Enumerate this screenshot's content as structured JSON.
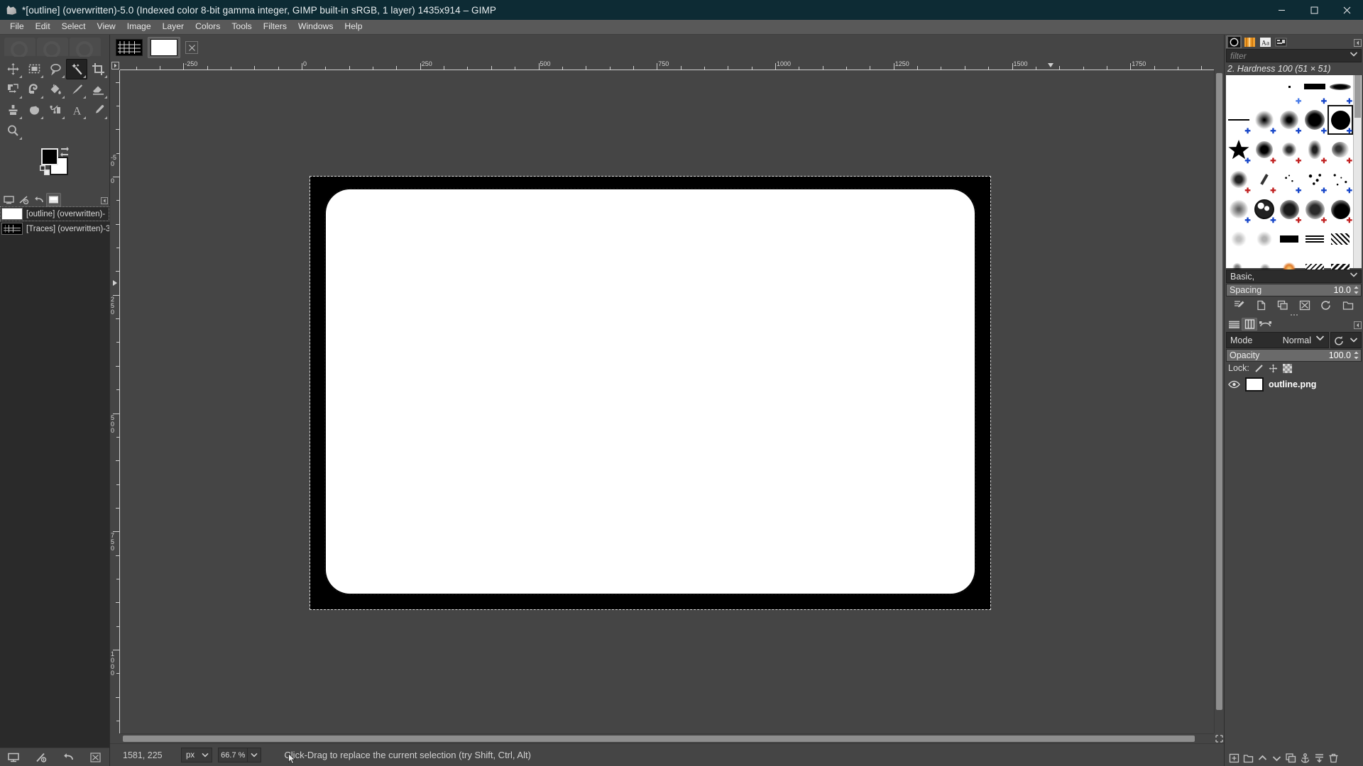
{
  "window": {
    "title": "*[outline] (overwritten)-5.0 (Indexed color 8-bit gamma integer, GIMP built-in sRGB, 1 layer) 1435x914 – GIMP",
    "app_icon": "wilber-icon",
    "controls": {
      "minimize": "−",
      "maximize": "▢",
      "close": "✕"
    }
  },
  "menubar": {
    "items": [
      {
        "label": "File"
      },
      {
        "label": "Edit"
      },
      {
        "label": "Select"
      },
      {
        "label": "View"
      },
      {
        "label": "Image"
      },
      {
        "label": "Layer"
      },
      {
        "label": "Colors"
      },
      {
        "label": "Tools"
      },
      {
        "label": "Filters"
      },
      {
        "label": "Windows"
      },
      {
        "label": "Help"
      }
    ]
  },
  "toolbox": {
    "tools": [
      {
        "name": "move-tool",
        "icon": "move-icon",
        "active": false
      },
      {
        "name": "rectangle-select-tool",
        "icon": "rectangle-select-icon",
        "active": false
      },
      {
        "name": "free-select-tool",
        "icon": "lasso-icon",
        "active": false
      },
      {
        "name": "fuzzy-select-tool",
        "icon": "magic-wand-icon",
        "active": true
      },
      {
        "name": "crop-tool",
        "icon": "crop-icon",
        "active": false
      },
      {
        "name": "unified-transform-tool",
        "icon": "transform-icon",
        "active": false
      },
      {
        "name": "warp-transform-tool",
        "icon": "warp-icon",
        "active": false
      },
      {
        "name": "bucket-fill-tool",
        "icon": "bucket-fill-icon",
        "active": false
      },
      {
        "name": "paintbrush-tool",
        "icon": "paintbrush-icon",
        "active": false
      },
      {
        "name": "eraser-tool",
        "icon": "eraser-icon",
        "active": false
      },
      {
        "name": "clone-tool",
        "icon": "clone-stamp-icon",
        "active": false
      },
      {
        "name": "smudge-tool",
        "icon": "smudge-icon",
        "active": false
      },
      {
        "name": "paths-tool",
        "icon": "paths-icon",
        "active": false
      },
      {
        "name": "text-tool",
        "icon": "text-icon",
        "active": false
      },
      {
        "name": "color-picker-tool",
        "icon": "eyedropper-icon",
        "active": false
      },
      {
        "name": "zoom-tool",
        "icon": "magnifier-icon",
        "active": false
      }
    ],
    "colors": {
      "foreground": "#000000",
      "background": "#ffffff",
      "swap_icon": "swap-colors-icon",
      "reset_icon": "reset-colors-icon"
    }
  },
  "images_dock": {
    "tabs": [
      {
        "name": "tab-images",
        "icon": "images-icon",
        "selected": false
      },
      {
        "name": "tab-document-history",
        "icon": "history-icon",
        "selected": false
      },
      {
        "name": "tab-undo-history",
        "icon": "undo-icon",
        "selected": false
      },
      {
        "name": "tab-layers-thumb",
        "icon": "layer-thumb-icon",
        "selected": true
      }
    ],
    "items": [
      {
        "label": "[outline] (overwritten)-",
        "thumb": "white",
        "selected": true
      },
      {
        "label": "[Traces] (overwritten)-3",
        "thumb": "traces",
        "selected": false
      }
    ]
  },
  "left_bottom_buttons": [
    {
      "name": "new-image-button",
      "icon": "canvas-icon"
    },
    {
      "name": "raise-image-button",
      "icon": "slash-zero-icon"
    },
    {
      "name": "delete-image-button",
      "icon": "delete-icon"
    }
  ],
  "canvas_tabs": [
    {
      "name": "canvas-tab-traces",
      "thumb": "traces",
      "selected": false,
      "closable": false
    },
    {
      "name": "canvas-tab-outline",
      "thumb": "white",
      "selected": true,
      "closable": true,
      "close_label": "⊠"
    }
  ],
  "rulers": {
    "horizontal": [
      "-250",
      "0",
      "250",
      "500",
      "750",
      "1000",
      "1250",
      "1500",
      "1750"
    ],
    "vertical": [
      "-50",
      "0",
      "250",
      "500",
      "750",
      "1000"
    ],
    "unit": "px"
  },
  "statusbar": {
    "position": "1581, 225",
    "unit": "px",
    "zoom": "66.7 %",
    "hint": "Click-Drag to replace the current selection (try Shift, Ctrl, Alt)"
  },
  "brushes_panel": {
    "tabs": [
      {
        "name": "tab-brushes",
        "icon": "brush-circle-icon",
        "selected": true
      },
      {
        "name": "tab-patterns",
        "icon": "gradient-icon",
        "selected": false
      },
      {
        "name": "tab-fonts",
        "icon": "font-aa-icon",
        "selected": false
      },
      {
        "name": "tab-templates",
        "icon": "template-icon",
        "selected": false
      }
    ],
    "collapse_icon": "collapse-left-icon",
    "filter_placeholder": "filter",
    "selected_brush": "2. Hardness 100 (51 × 51)",
    "tag_selector": "Basic,",
    "spacing_label": "Spacing",
    "spacing_value": "10.0",
    "actions": [
      {
        "name": "edit-brush-button",
        "icon": "edit-icon"
      },
      {
        "name": "new-brush-button",
        "icon": "new-doc-icon"
      },
      {
        "name": "duplicate-brush-button",
        "icon": "duplicate-icon"
      },
      {
        "name": "delete-brush-button",
        "icon": "delete-x-icon"
      },
      {
        "name": "refresh-brushes-button",
        "icon": "refresh-icon"
      },
      {
        "name": "open-brush-folder-button",
        "icon": "folder-icon"
      }
    ]
  },
  "layers_panel": {
    "tabs": [
      {
        "name": "tab-layers",
        "icon": "layers-icon",
        "selected": false
      },
      {
        "name": "tab-channels",
        "icon": "channels-icon",
        "selected": true
      },
      {
        "name": "tab-paths",
        "icon": "paths-tab-icon",
        "selected": false
      }
    ],
    "collapse_icon": "collapse-left-icon",
    "mode_label": "Mode",
    "mode_value": "Normal",
    "revert_icon": "revert-icon",
    "opacity_label": "Opacity",
    "opacity_value": "100.0",
    "lock_label": "Lock:",
    "lock_items": [
      {
        "name": "lock-pixels-button",
        "icon": "brush-stroke-icon"
      },
      {
        "name": "lock-position-button",
        "icon": "move-cross-icon"
      },
      {
        "name": "lock-alpha-button",
        "icon": "checkerboard-icon"
      }
    ],
    "layers": [
      {
        "name": "layer-outline-png",
        "label": "outline.png",
        "visible": true,
        "thumb": "white"
      }
    ],
    "buttons": [
      {
        "name": "new-layer-button",
        "icon": "new-layer-icon"
      },
      {
        "name": "new-group-button",
        "icon": "new-group-icon"
      },
      {
        "name": "raise-layer-button",
        "icon": "chevron-up-icon"
      },
      {
        "name": "lower-layer-button",
        "icon": "chevron-down-icon"
      },
      {
        "name": "duplicate-layer-button",
        "icon": "duplicate-layer-icon"
      },
      {
        "name": "anchor-layer-button",
        "icon": "anchor-icon"
      },
      {
        "name": "merge-down-button",
        "icon": "merge-icon"
      },
      {
        "name": "delete-layer-button",
        "icon": "trash-icon"
      }
    ]
  },
  "canvas": {
    "image_background": "#000000",
    "image_foreground": "#ffffff",
    "selection_style": "marching-ants"
  }
}
